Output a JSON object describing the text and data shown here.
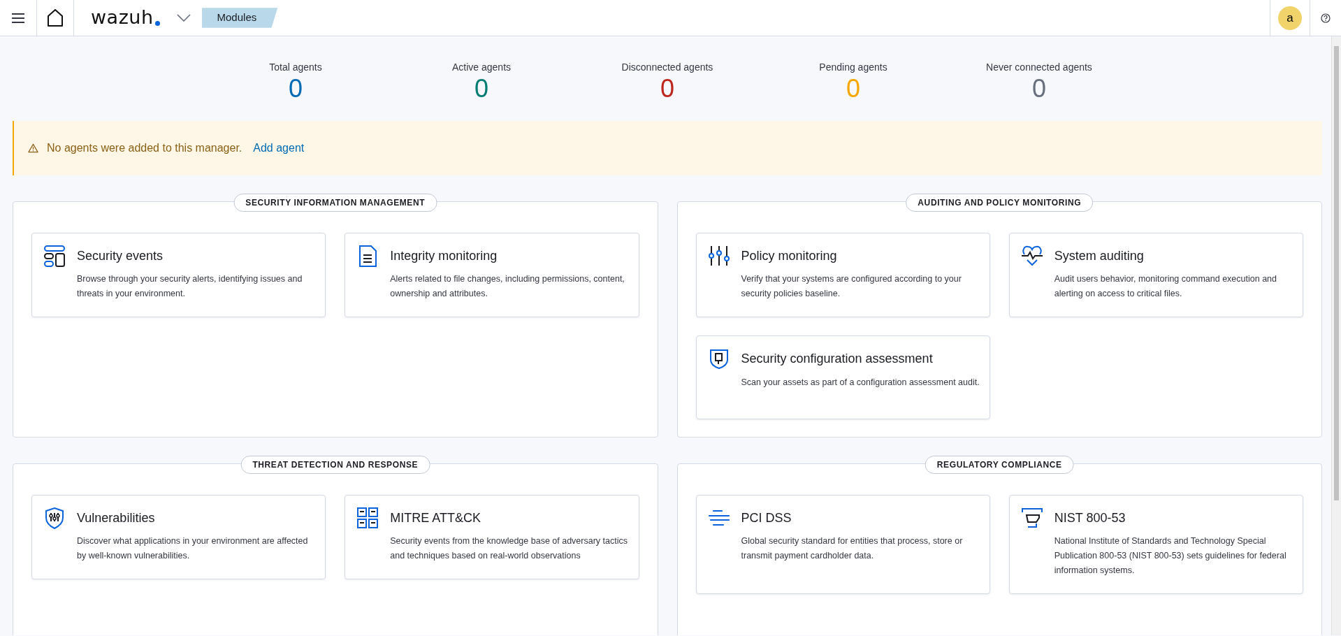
{
  "header": {
    "logo": "wazuh",
    "breadcrumb": "Modules",
    "avatar": "a"
  },
  "stats": [
    {
      "label": "Total agents",
      "value": "0",
      "color": "#006bb4"
    },
    {
      "label": "Active agents",
      "value": "0",
      "color": "#017d73"
    },
    {
      "label": "Disconnected agents",
      "value": "0",
      "color": "#bd271e"
    },
    {
      "label": "Pending agents",
      "value": "0",
      "color": "#f5a700"
    },
    {
      "label": "Never connected agents",
      "value": "0",
      "color": "#69707d"
    }
  ],
  "callout": {
    "text": "No agents were added to this manager.",
    "link": "Add agent"
  },
  "panels": [
    {
      "title": "SECURITY INFORMATION MANAGEMENT",
      "modules": [
        {
          "kind": "events",
          "title": "Security events",
          "description": "Browse through your security alerts, identifying issues and threats in your environment."
        },
        {
          "kind": "integrity",
          "title": "Integrity monitoring",
          "description": "Alerts related to file changes, including permissions, content, ownership and attributes."
        }
      ]
    },
    {
      "title": "AUDITING AND POLICY MONITORING",
      "modules": [
        {
          "kind": "policy",
          "title": "Policy monitoring",
          "description": "Verify that your systems are configured according to your security policies baseline."
        },
        {
          "kind": "audit",
          "title": "System auditing",
          "description": "Audit users behavior, monitoring command execution and alerting on access to critical files."
        },
        {
          "kind": "sca",
          "title": "Security configuration assessment",
          "description": "Scan your assets as part of a configuration assessment audit."
        }
      ]
    },
    {
      "title": "THREAT DETECTION AND RESPONSE",
      "modules": [
        {
          "kind": "vuln",
          "title": "Vulnerabilities",
          "description": "Discover what applications in your environment are affected by well-known vulnerabilities."
        },
        {
          "kind": "mitre",
          "title": "MITRE ATT&CK",
          "description": "Security events from the knowledge base of adversary tactics and techniques based on real-world observations"
        }
      ]
    },
    {
      "title": "REGULATORY COMPLIANCE",
      "modules": [
        {
          "kind": "pci",
          "title": "PCI DSS",
          "description": "Global security standard for entities that process, store or transmit payment cardholder data."
        },
        {
          "kind": "nist",
          "title": "NIST 800-53",
          "description": "National Institute of Standards and Technology Special Publication 800-53 (NIST 800-53) sets guidelines for federal information systems."
        }
      ]
    }
  ]
}
